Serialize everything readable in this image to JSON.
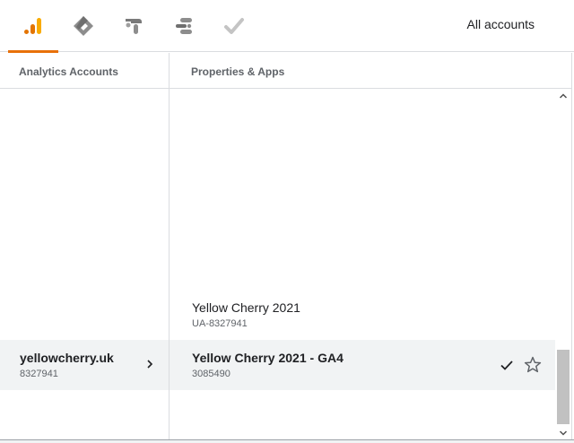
{
  "header": {
    "products": [
      {
        "name": "analytics",
        "icon": "analytics-icon",
        "active": true
      },
      {
        "name": "tag-manager",
        "icon": "tag-manager-icon",
        "active": false
      },
      {
        "name": "optimize",
        "icon": "optimize-icon",
        "active": false
      },
      {
        "name": "data-studio",
        "icon": "data-studio-icon",
        "active": false
      },
      {
        "name": "surveys",
        "icon": "surveys-icon",
        "active": false
      }
    ],
    "all_accounts": "All accounts"
  },
  "columns": {
    "accounts_header": "Analytics Accounts",
    "properties_header": "Properties & Apps"
  },
  "accounts": [
    {
      "name": "yellowcherry.uk",
      "id": "8327941",
      "selected": true
    }
  ],
  "properties": [
    {
      "name": "Yellow Cherry 2021",
      "id": "UA-8327941",
      "selected": false
    },
    {
      "name": "Yellow Cherry 2021 - GA4",
      "id": "3085490",
      "selected": true
    }
  ],
  "colors": {
    "accent": "#e8710a",
    "selected_bg": "#f1f3f4",
    "divider": "#dadce0"
  }
}
